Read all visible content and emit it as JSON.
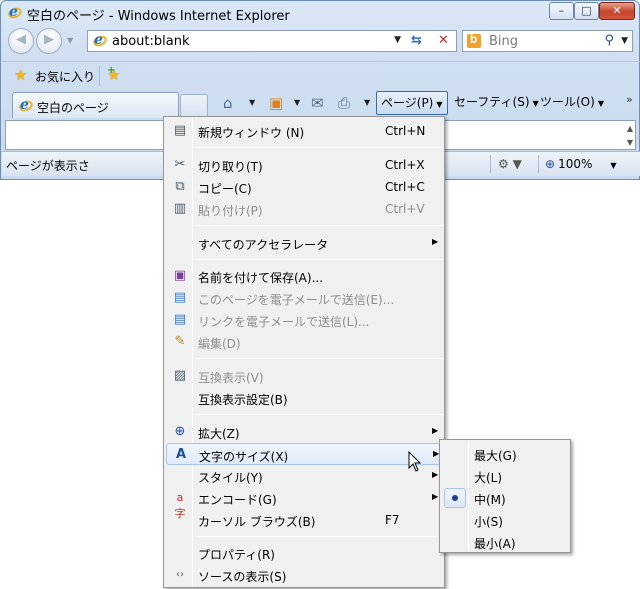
{
  "window": {
    "title": "空白のページ - Windows Internet Explorer",
    "caption_buttons": {
      "minimize": "–",
      "maximize": "□",
      "close": "✕"
    }
  },
  "nav": {
    "address": "about:blank",
    "search_placeholder": "Bing"
  },
  "favorites": {
    "label": "お気に入り"
  },
  "tabs": [
    {
      "label": "空白のページ",
      "active": true
    }
  ],
  "command_bar": {
    "page": "ページ(P)",
    "safety": "セーフティ(S)",
    "tools": "ツール(O)",
    "more": "»"
  },
  "status": {
    "text": "ページが表示さ",
    "zoom": "100%"
  },
  "page_menu": {
    "items": [
      {
        "label": "新規ウィンドウ (N)",
        "shortcut": "Ctrl+N",
        "icon": "new-window-icon",
        "enabled": true
      },
      {
        "label": "切り取り(T)",
        "shortcut": "Ctrl+X",
        "icon": "cut-icon",
        "enabled": true
      },
      {
        "label": "コピー(C)",
        "shortcut": "Ctrl+C",
        "icon": "copy-icon",
        "enabled": true
      },
      {
        "label": "貼り付け(P)",
        "shortcut": "Ctrl+V",
        "icon": "paste-icon",
        "enabled": false
      },
      {
        "label": "すべてのアクセラレータ",
        "shortcut": "",
        "icon": "",
        "enabled": true
      },
      {
        "label": "名前を付けて保存(A)...",
        "shortcut": "",
        "icon": "save-icon",
        "enabled": true
      },
      {
        "label": "このページを電子メールで送信(E)...",
        "shortcut": "",
        "icon": "email-page-icon",
        "enabled": false
      },
      {
        "label": "リンクを電子メールで送信(L)...",
        "shortcut": "",
        "icon": "email-link-icon",
        "enabled": false
      },
      {
        "label": "編集(D)",
        "shortcut": "",
        "icon": "edit-icon",
        "enabled": false
      },
      {
        "label": "互換表示(V)",
        "shortcut": "",
        "icon": "compat-view-icon",
        "enabled": false
      },
      {
        "label": "互換表示設定(B)",
        "shortcut": "",
        "icon": "",
        "enabled": true
      },
      {
        "label": "拡大(Z)",
        "shortcut": "",
        "icon": "zoom-icon",
        "enabled": true
      },
      {
        "label": "文字のサイズ(X)",
        "shortcut": "",
        "icon": "text-size-icon",
        "enabled": true
      },
      {
        "label": "スタイル(Y)",
        "shortcut": "",
        "icon": "",
        "enabled": true
      },
      {
        "label": "エンコード(G)",
        "shortcut": "",
        "icon": "encoding-icon",
        "enabled": true
      },
      {
        "label": "カーソル ブラウズ(B)",
        "shortcut": "F7",
        "icon": "",
        "enabled": true
      },
      {
        "label": "プロパティ(R)",
        "shortcut": "",
        "icon": "",
        "enabled": true
      },
      {
        "label": "ソースの表示(S)",
        "shortcut": "",
        "icon": "view-source-icon",
        "enabled": true
      }
    ]
  },
  "text_size_menu": {
    "items": [
      {
        "label": "最大(G)",
        "selected": false
      },
      {
        "label": "大(L)",
        "selected": false
      },
      {
        "label": "中(M)",
        "selected": true
      },
      {
        "label": "小(S)",
        "selected": false
      },
      {
        "label": "最小(A)",
        "selected": false
      }
    ]
  }
}
